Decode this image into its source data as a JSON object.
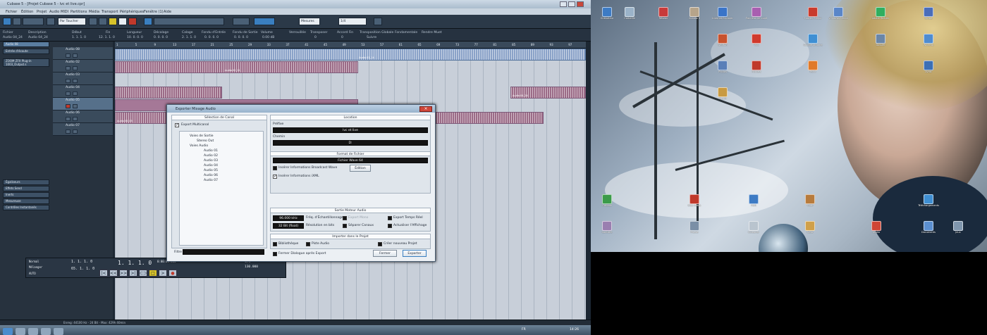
{
  "window": {
    "title": "Cubase 5 - [Projet Cubase 5 - lvc et live.cpr]",
    "menu": [
      "Fichier",
      "Édition",
      "Projet",
      "Audio",
      "MIDI",
      "Partitions",
      "Média",
      "Transport",
      "Périphériques",
      "Fenêtre (1)",
      "Aide"
    ],
    "toolbar": {
      "mode": "Par Toucher",
      "grid": "Mesures",
      "quantize": "1/4"
    }
  },
  "infoline": {
    "labels": [
      "Fichier",
      "Description",
      "Début",
      "Fin",
      "Longueur",
      "Décalage",
      "Calage",
      "Fondu d'Entrée",
      "Fondu de Sortie",
      "Volume",
      "Verrouillée",
      "Transposer",
      "Accord Fin",
      "Transposition Globale",
      "Fondamentale",
      "Rendre Muet"
    ],
    "values": [
      "Audio 04_24",
      "Audio 04_24",
      "1. 1. 1. 0",
      "12. 1. 1. 0",
      "10. 0. 0. 0",
      "0. 0. 0. 0",
      "2. 1. 1. 0",
      "0. 0. 0. 0",
      "0. 0. 0. 0",
      "0.00 dB",
      "",
      "0",
      "0",
      "Suivre",
      "",
      ""
    ]
  },
  "inspector": {
    "track": "Audio 08",
    "items": [
      "Entrée d'écoute",
      "ZOOM ZFX Plug-in",
      "1003_Output.s",
      "Égaliseurs",
      "Effets Send",
      "Inerts",
      "Mesureuse",
      "Contrôles Instantanés"
    ],
    "sections": [
      "Égaliseurs",
      "Effets Send",
      "Inerts",
      "Mesureuse",
      "Contrôles Instantanés"
    ]
  },
  "tracks": [
    "Audio 08",
    "Audio 02",
    "Audio 03",
    "Audio 04",
    "Audio 05",
    "Audio 06",
    "Audio 07"
  ],
  "ruler": [
    "1",
    "5",
    "9",
    "13",
    "17",
    "21",
    "25",
    "29",
    "33",
    "37",
    "41",
    "45",
    "49",
    "53",
    "57",
    "61",
    "65",
    "69",
    "73",
    "77",
    "81",
    "85",
    "89",
    "93",
    "97"
  ],
  "clips": {
    "a": "Audio 01_14",
    "b": "Audio 02_11",
    "c": "Audio 04_24",
    "d": "Audio 06_05"
  },
  "transport": {
    "left": "1. 1. 1. 0",
    "right": "65. 1. 1. 0",
    "position": "1. 1. 1. 0",
    "time": "0:00:00.000",
    "tempo": "130.000",
    "sig": "4/4",
    "labels": [
      "Normal",
      "Mélanger",
      "AUTO"
    ],
    "buttons": [
      "|<",
      "<<",
      ">>",
      ">|",
      "⊂⊃",
      "□",
      ">",
      "●"
    ]
  },
  "status": "Enreg: 44100 Hz - 24 Bit - Max: 429h 40min",
  "dialog": {
    "title": "Exporter Mixage Audio",
    "channel_header": "Sélection de Canal",
    "export_multi": "Export Multicanal",
    "tree": [
      "Voies de Sortie",
      "Stereo Out",
      "Voies Audio",
      "Audio 01",
      "Audio 02",
      "Audio 03",
      "Audio 04",
      "Audio 05",
      "Audio 06",
      "Audio 07"
    ],
    "location_header": "Location",
    "name_label": "Préfixe",
    "name_value": "lvc et live",
    "path_label": "Chemin",
    "path_value": "D:",
    "format_header": "Format de Fichier",
    "format_value": "Fichier Wave 64",
    "bwf": "Insérer Informations Broadcast Wave",
    "edit_btn": "Édition",
    "ixml": "Insérer Informations iXML",
    "engine_header": "Sortie Moteur Audio",
    "rate_value": "96.000 kHz",
    "rate_label": "Fréq. d'Échantillonnage",
    "mono": "Export Mono",
    "realtime": "Export Temps Réel",
    "bits_value": "32 Bit (float)",
    "bits_label": "Résolution en bits",
    "split": "Séparer Canaux",
    "monitor": "Actualiser l'Affichage",
    "import_header": "Importer dans le Projet",
    "pool": "Bibliothèque",
    "audiotrack": "Piste Audio",
    "newproject": "Créer nouveau Projet",
    "close_after": "Fermer Dialogue après Export",
    "filter_label": "Filtre",
    "close_btn": "Fermer",
    "export_btn": "Exporter"
  },
  "taskbar": {
    "lang": "FR",
    "time": "14:26"
  },
  "desktop_icons": [
    "Ordinateur",
    "Corbeille",
    "Réseau",
    "Cubase 5",
    "Internet Explorer",
    "Panneau de config",
    "Mozilla Firefox",
    "Windows Media",
    "Adobe Reader",
    "Skype",
    "WinRAR",
    "VLC",
    "Google Chrome",
    "Dossier",
    "Winamp",
    "Photos",
    "Fichiers",
    "Paint",
    "Avast",
    "Steam",
    "Outlook",
    "Bloc-notes",
    "MSN",
    "Outil",
    "Téléchargements",
    "Contrôle",
    "Picasa",
    "CCleaner",
    "Nero",
    "Audio",
    "Documents",
    "Jeux"
  ]
}
